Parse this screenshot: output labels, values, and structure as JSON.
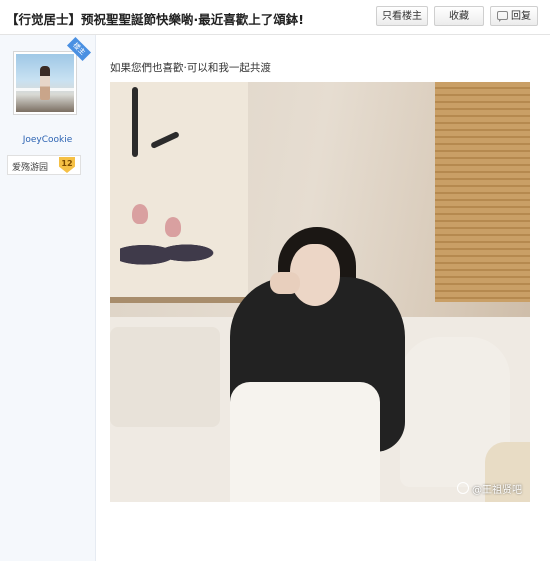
{
  "header": {
    "title": "【行觉居士】预祝聖聖誕節快樂喲·最近喜歡上了頌鉢!",
    "only_op_label": "只看楼主",
    "favorite_label": "收藏",
    "reply_label": "回复"
  },
  "sidebar": {
    "op_badge": "楼主",
    "username": "JoeyCookie",
    "level_name": "爱殇游园",
    "level_number": "12"
  },
  "post": {
    "text": "如果您們也喜歡·可以和我一起共渡",
    "watermark": "@王祖贤吧"
  },
  "icons": {
    "reply": "reply-icon",
    "watermark": "weibo-icon"
  }
}
